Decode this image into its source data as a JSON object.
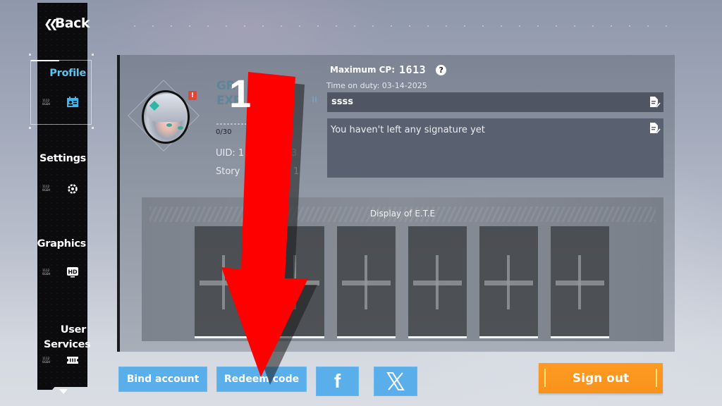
{
  "sidebar": {
    "back_label": "Back",
    "items": [
      {
        "label": "Profile",
        "tiny": "1112 0GEH",
        "icon": "profile-card-icon",
        "active": true
      },
      {
        "label": "Settings",
        "tiny": "1112 0GEH",
        "icon": "settings-gear-icon",
        "active": false
      },
      {
        "label": "Graphics",
        "tiny": "1112 0GEH",
        "icon": "hd-icon",
        "active": false
      },
      {
        "label": "User Services",
        "tiny": "1112 0GEH",
        "icon": "ticket-icon",
        "active": false
      }
    ]
  },
  "profile": {
    "rank_line1": "GR",
    "rank_line2": "EXP",
    "exp_value": "0/30",
    "uid_label": "UID: 1",
    "uid_tail": "3",
    "story_label": "Story",
    "story_tail": "1",
    "alert_badge": "!",
    "max_cp_label": "Maximum CP:",
    "max_cp_value": "1613",
    "help_glyph": "?",
    "time_on_duty": "Time on duty: 03-14-2025",
    "name_value": "ssss",
    "signature_value": "You haven't left any signature yet"
  },
  "ete": {
    "title": "Display of E.T.E",
    "slot_count": 6
  },
  "buttons": {
    "bind_account": "Bind account",
    "redeem_code": "Redeem code",
    "facebook_glyph": "f",
    "x_glyph": "𝕏",
    "sign_out": "Sign out"
  },
  "annotation": {
    "number": "1",
    "color": "#ff0000"
  },
  "colors": {
    "accent_blue": "#5aaeea",
    "active_nav": "#5cc4ee",
    "sign_out_orange": "#f7921c",
    "alert_red": "#e0473a"
  }
}
